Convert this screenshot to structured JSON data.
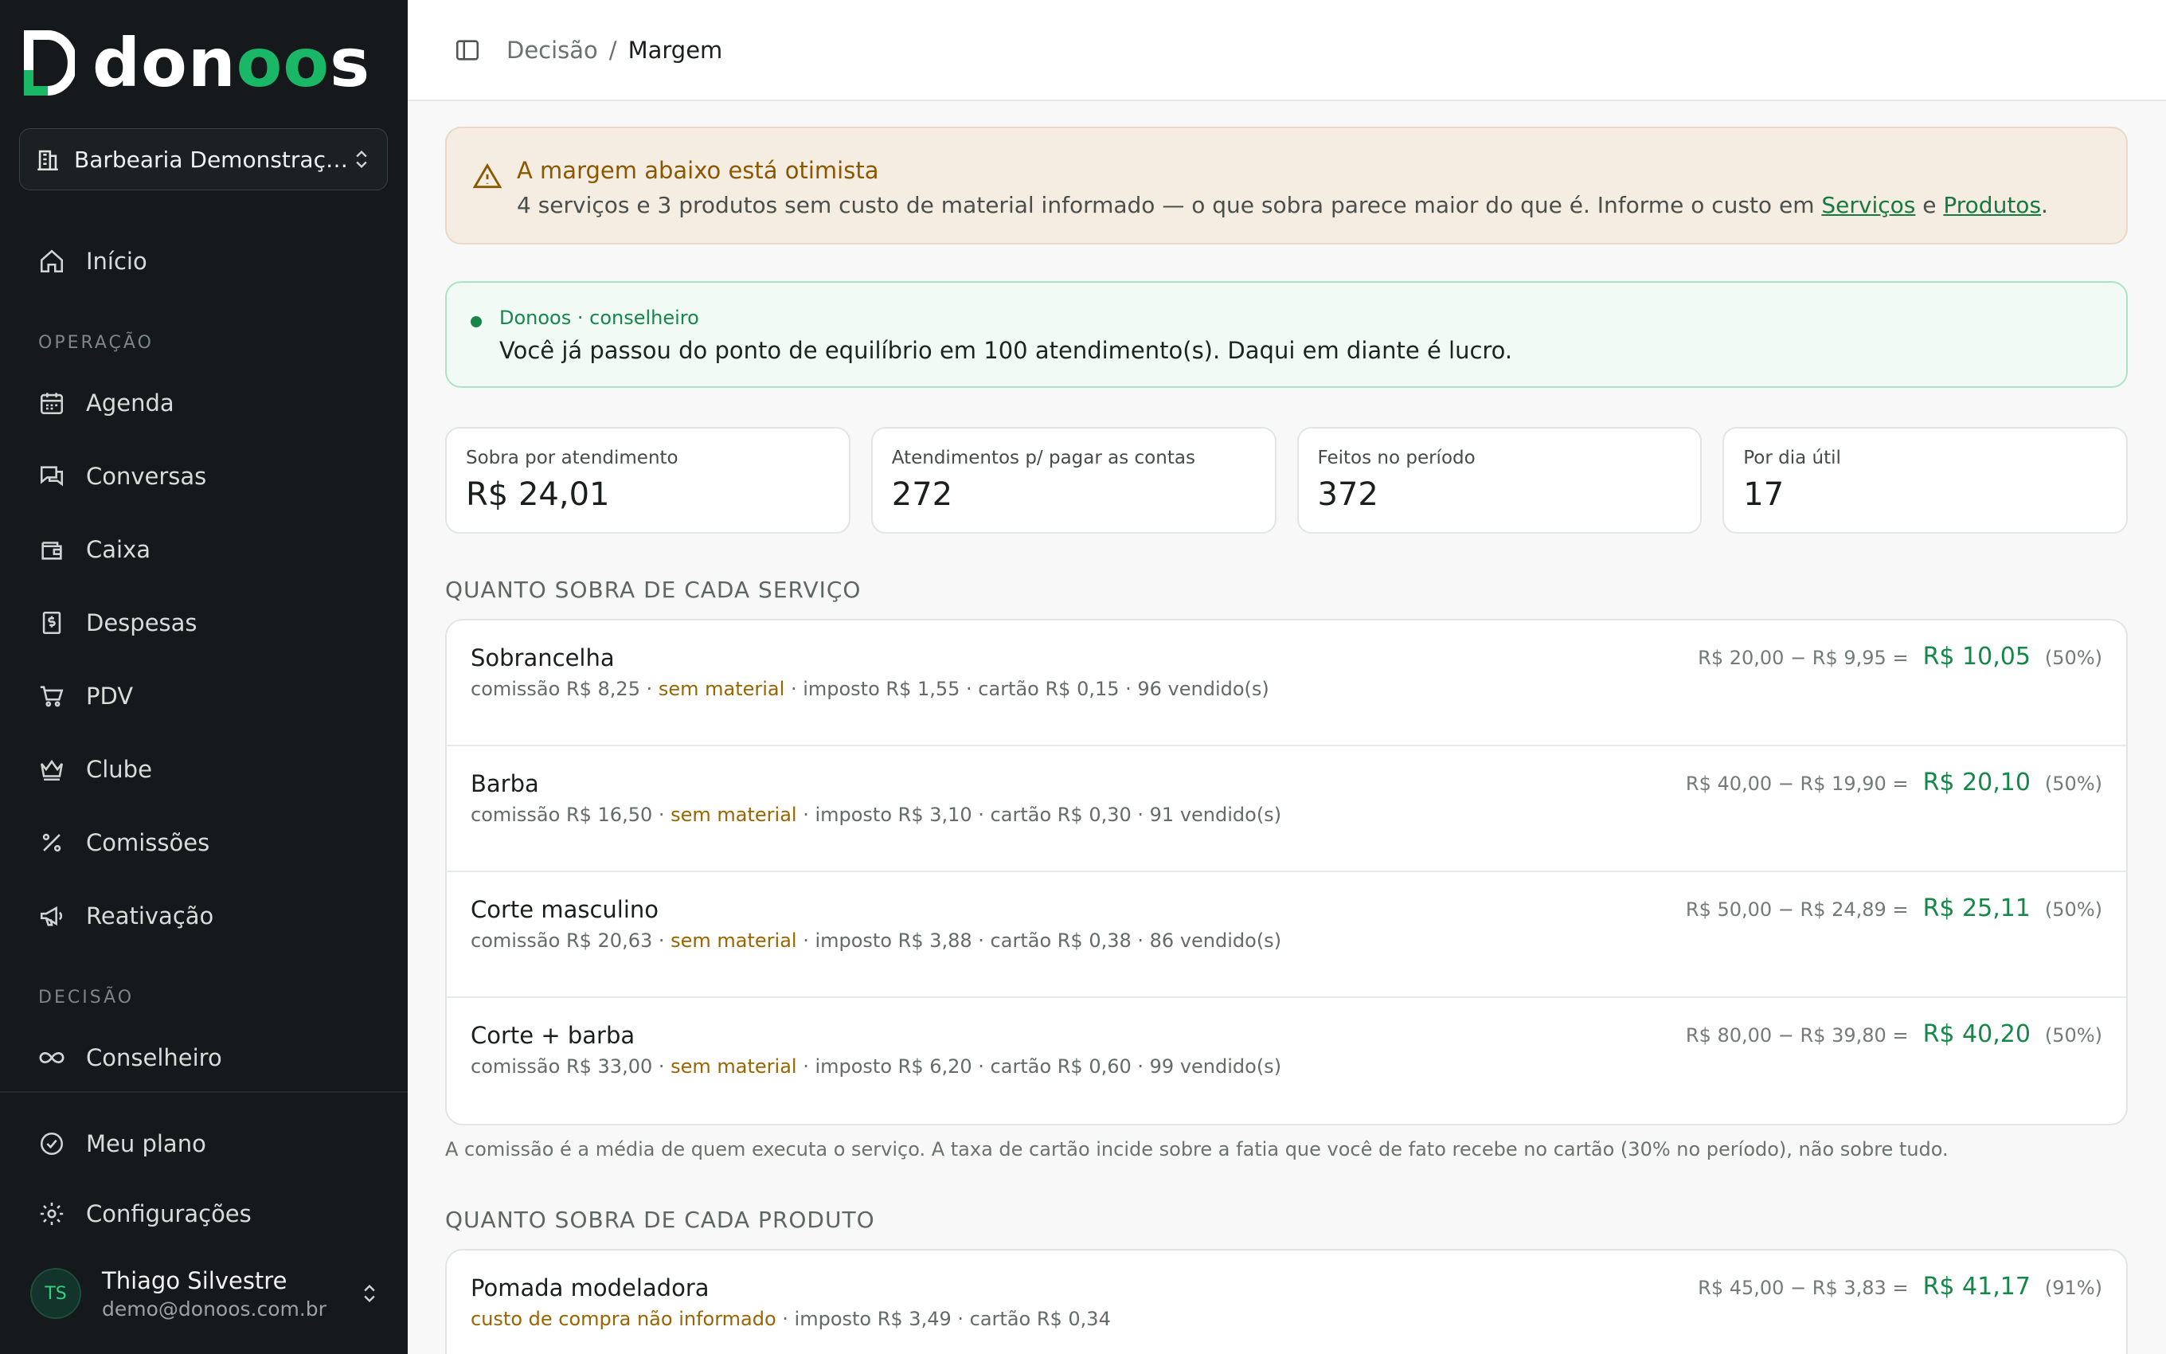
{
  "brand": {
    "name_prefix": "don",
    "name_highlight": "oo",
    "name_suffix": "s",
    "accent_color": "#19b766"
  },
  "business_selector": {
    "label": "Barbearia Demonstração"
  },
  "sidebar": {
    "home": "Início",
    "section_operation": "OPERAÇÃO",
    "items_operation": [
      {
        "label": "Agenda",
        "icon": "calendar-icon"
      },
      {
        "label": "Conversas",
        "icon": "chat-icon"
      },
      {
        "label": "Caixa",
        "icon": "wallet-icon"
      },
      {
        "label": "Despesas",
        "icon": "receipt-icon"
      },
      {
        "label": "PDV",
        "icon": "cart-icon"
      },
      {
        "label": "Clube",
        "icon": "crown-icon"
      },
      {
        "label": "Comissões",
        "icon": "percent-icon"
      },
      {
        "label": "Reativação",
        "icon": "megaphone-icon"
      }
    ],
    "section_decision": "DECISÃO",
    "advisor": "Conselheiro",
    "plan": "Meu plano",
    "settings": "Configurações"
  },
  "user": {
    "initials": "TS",
    "name": "Thiago Silvestre",
    "email": "demo@donoos.com.br"
  },
  "breadcrumb": {
    "parent": "Decisão",
    "separator": "/",
    "current": "Margem"
  },
  "warning": {
    "title": "A margem abaixo está otimista",
    "body": "4 serviços e 3 produtos sem custo de material informado — o que sobra parece maior do que é. Informe o custo em ",
    "link_services": "Serviços",
    "conjunction": " e ",
    "link_products": "Produtos",
    "period": "."
  },
  "advisor_card": {
    "title": "Donoos · conselheiro",
    "message": "Você já passou do ponto de equilíbrio em 100 atendimento(s). Daqui em diante é lucro."
  },
  "kpis": [
    {
      "label": "Sobra por atendimento",
      "value": "R$ 24,01"
    },
    {
      "label": "Atendimentos p/ pagar as contas",
      "value": "272"
    },
    {
      "label": "Feitos no período",
      "value": "372"
    },
    {
      "label": "Por dia útil",
      "value": "17"
    }
  ],
  "services": {
    "title": "QUANTO SOBRA DE CADA SERVIÇO",
    "rows": [
      {
        "name": "Sobrancelha",
        "commission": "comissão R$ 8,25 · ",
        "material": "sem material",
        "rest": " · imposto R$ 1,55 · cartão R$ 0,15 · 96 vendido(s)",
        "calc": "R$ 20,00 − R$ 9,95 =",
        "net": "R$ 10,05",
        "pct": "(50%)"
      },
      {
        "name": "Barba",
        "commission": "comissão R$ 16,50 · ",
        "material": "sem material",
        "rest": " · imposto R$ 3,10 · cartão R$ 0,30 · 91 vendido(s)",
        "calc": "R$ 40,00 − R$ 19,90 =",
        "net": "R$ 20,10",
        "pct": "(50%)"
      },
      {
        "name": "Corte masculino",
        "commission": "comissão R$ 20,63 · ",
        "material": "sem material",
        "rest": " · imposto R$ 3,88 · cartão R$ 0,38 · 86 vendido(s)",
        "calc": "R$ 50,00 − R$ 24,89 =",
        "net": "R$ 25,11",
        "pct": "(50%)"
      },
      {
        "name": "Corte + barba",
        "commission": "comissão R$ 33,00 · ",
        "material": "sem material",
        "rest": " · imposto R$ 6,20 · cartão R$ 0,60 · 99 vendido(s)",
        "calc": "R$ 80,00 − R$ 39,80 =",
        "net": "R$ 40,20",
        "pct": "(50%)"
      }
    ],
    "footnote": "A comissão é a média de quem executa o serviço. A taxa de cartão incide sobre a fatia que você de fato recebe no cartão (30% no período), não sobre tudo."
  },
  "products": {
    "title": "QUANTO SOBRA DE CADA PRODUTO",
    "rows": [
      {
        "name": "Pomada modeladora",
        "material": "custo de compra não informado",
        "rest": " · imposto R$ 3,49 · cartão R$ 0,34",
        "calc": "R$ 45,00 − R$ 3,83 =",
        "net": "R$ 41,17",
        "pct": "(91%)"
      }
    ]
  }
}
